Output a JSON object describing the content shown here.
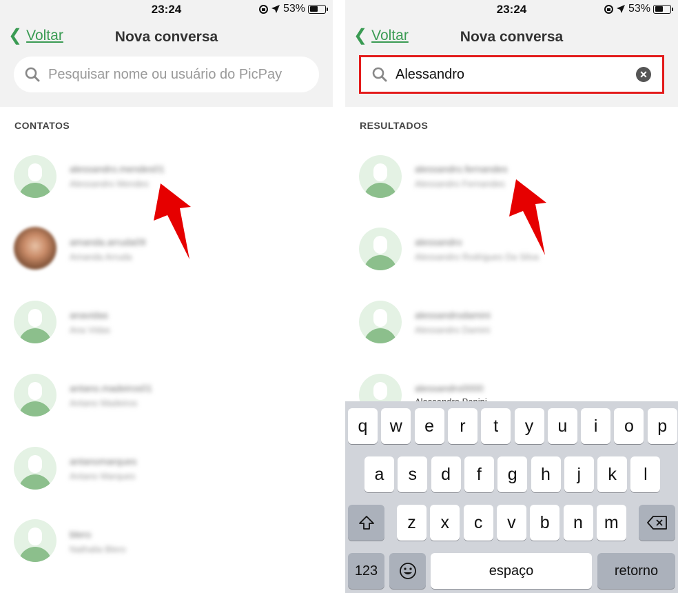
{
  "status": {
    "time": "23:24",
    "battery": "53%"
  },
  "nav": {
    "back_label": "Voltar",
    "title": "Nova conversa"
  },
  "left": {
    "search_placeholder": "Pesquisar nome ou usuário do PicPay",
    "section_label": "CONTATOS",
    "contacts": [
      {
        "username": "alessandro.mendes01",
        "name": "Alessandro Mendes"
      },
      {
        "username": "amanda.arruda09",
        "name": "Amanda Arruda"
      },
      {
        "username": "anavidas",
        "name": "Ana Vidas"
      },
      {
        "username": "antano.madeiros01",
        "name": "Antano Madeiros"
      },
      {
        "username": "antanomarques",
        "name": "Antano Marques"
      },
      {
        "username": "blero",
        "name": "Nathalia Blero"
      }
    ]
  },
  "right": {
    "search_value": "Alessandro",
    "section_label": "RESULTADOS",
    "results": [
      {
        "username": "alessandro.fernandes",
        "name": "Alessandro Fernandes"
      },
      {
        "username": "alessandro",
        "name": "Alessandro Rodrigues Da Silva"
      },
      {
        "username": "alessandrodamini",
        "name": "Alessandro Damini"
      },
      {
        "username": "alessandro0000",
        "name": "Alessandro Panini"
      }
    ]
  },
  "keyboard": {
    "row1": [
      "q",
      "w",
      "e",
      "r",
      "t",
      "y",
      "u",
      "i",
      "o",
      "p"
    ],
    "row2": [
      "a",
      "s",
      "d",
      "f",
      "g",
      "h",
      "j",
      "k",
      "l"
    ],
    "row3": [
      "z",
      "x",
      "c",
      "v",
      "b",
      "n",
      "m"
    ],
    "shift_icon": "shift-icon",
    "backspace_icon": "backspace-icon",
    "numbers_label": "123",
    "emoji_icon": "emoji-icon",
    "space_label": "espaço",
    "return_label": "retorno"
  },
  "colors": {
    "accent": "#3a9b53",
    "highlight": "#e31b1b",
    "arrow": "#e60000"
  }
}
